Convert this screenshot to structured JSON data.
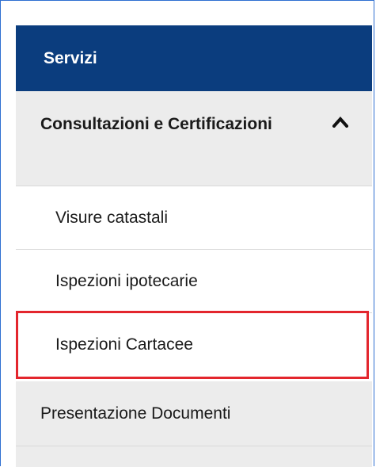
{
  "menu": {
    "header": "Servizi",
    "group": {
      "title": "Consultazioni e Certificazioni",
      "expanded_icon": "chevron-up-icon"
    },
    "items": [
      {
        "label": "Visure catastali"
      },
      {
        "label": "Ispezioni ipotecarie"
      },
      {
        "label": "Ispezioni Cartacee",
        "highlighted": true
      }
    ],
    "sections": [
      {
        "label": "Presentazione Documenti"
      }
    ]
  },
  "colors": {
    "header_bg": "#0b3d7e",
    "group_bg": "#ececec",
    "highlight_border": "#e3262d",
    "frame_border": "#2f6fd1"
  }
}
